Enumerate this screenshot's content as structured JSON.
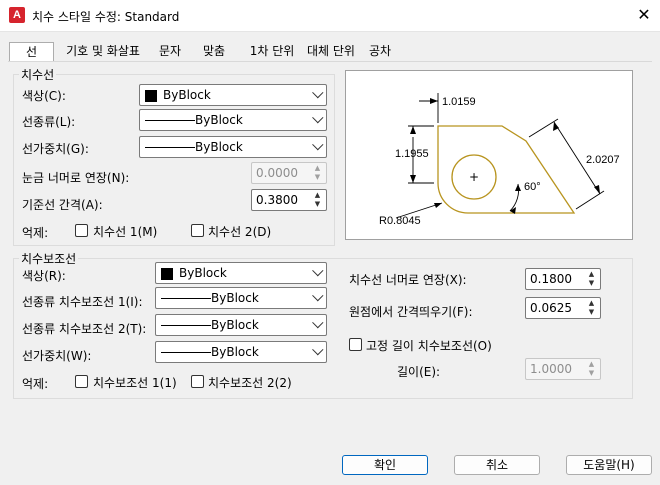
{
  "window": {
    "title": "치수 스타일 수정: Standard",
    "app_icon_letter": "A",
    "close_glyph": "✕"
  },
  "tabs": [
    {
      "label": "선",
      "active": true
    },
    {
      "label": "기호 및 화살표",
      "active": false
    },
    {
      "label": "문자",
      "active": false
    },
    {
      "label": "맞춤",
      "active": false
    },
    {
      "label": "1차 단위",
      "active": false
    },
    {
      "label": "대체 단위",
      "active": false
    },
    {
      "label": "공차",
      "active": false
    }
  ],
  "dim_lines": {
    "legend": "치수선",
    "color_label": "색상(C):",
    "color_value": "ByBlock",
    "linetype_label": "선종류(L):",
    "linetype_value": "ByBlock",
    "lineweight_label": "선가중치(G):",
    "lineweight_value": "ByBlock",
    "extend_label": "눈금 너머로 연장(N):",
    "extend_value": "0.0000",
    "baseline_label": "기준선 간격(A):",
    "baseline_value": "0.3800",
    "suppress_label": "억제:",
    "suppress_1": "치수선 1(M)",
    "suppress_2": "치수선 2(D)"
  },
  "ext_lines": {
    "legend": "치수보조선",
    "color_label": "색상(R):",
    "color_value": "ByBlock",
    "linetype1_label": "선종류 치수보조선 1(I):",
    "linetype1_value": "ByBlock",
    "linetype2_label": "선종류 치수보조선 2(T):",
    "linetype2_value": "ByBlock",
    "lineweight_label": "선가중치(W):",
    "lineweight_value": "ByBlock",
    "suppress_label": "억제:",
    "suppress_1": "치수보조선 1(1)",
    "suppress_2": "치수보조선 2(2)",
    "extend_label": "치수선 너머로 연장(X):",
    "extend_value": "0.1800",
    "offset_label": "원점에서 간격띄우기(F):",
    "offset_value": "0.0625",
    "fixed_label": "고정 길이 치수보조선(O)",
    "length_label": "길이(E):",
    "length_value": "1.0000"
  },
  "preview": {
    "dim_top": "1.0159",
    "dim_left": "1.1955",
    "dim_right": "2.0207",
    "angle": "60°",
    "radius": "R0.8045",
    "colors": {
      "shape": "#b8941f",
      "dims": "#000000"
    }
  },
  "buttons": {
    "ok": "확인",
    "cancel": "취소",
    "help": "도움말(H)"
  },
  "glyphs": {
    "spin_up": "▲",
    "spin_down": "▼",
    "plus": "+"
  }
}
